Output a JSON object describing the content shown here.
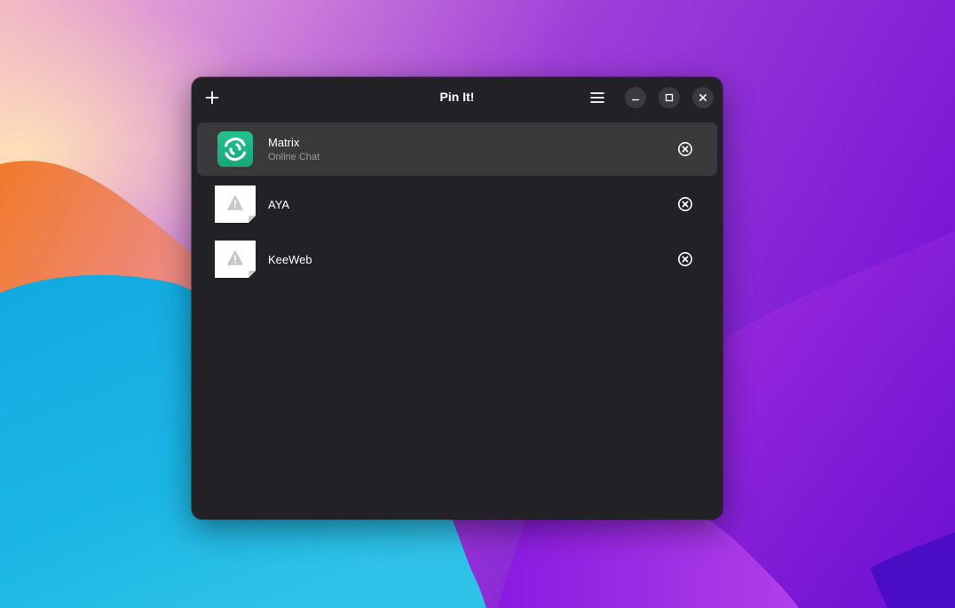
{
  "window": {
    "title": "Pin It!",
    "add_icon": "plus-icon",
    "menu_icon": "hamburger-menu-icon",
    "minimize_icon": "minimize-icon",
    "maximize_icon": "maximize-icon",
    "close_icon": "close-icon"
  },
  "pins": [
    {
      "title": "Matrix",
      "subtitle": "Online Chat",
      "icon": "matrix-app-icon",
      "selected": true
    },
    {
      "title": "AYA",
      "subtitle": "",
      "icon": "missing-image-icon",
      "selected": false
    },
    {
      "title": "KeeWeb",
      "subtitle": "",
      "icon": "missing-image-icon",
      "selected": false
    }
  ],
  "colors": {
    "window_bg": "#222226",
    "selected_row": "#3a3a3d",
    "subtitle": "#9a9a9e",
    "matrix_icon": "#1fb684"
  }
}
